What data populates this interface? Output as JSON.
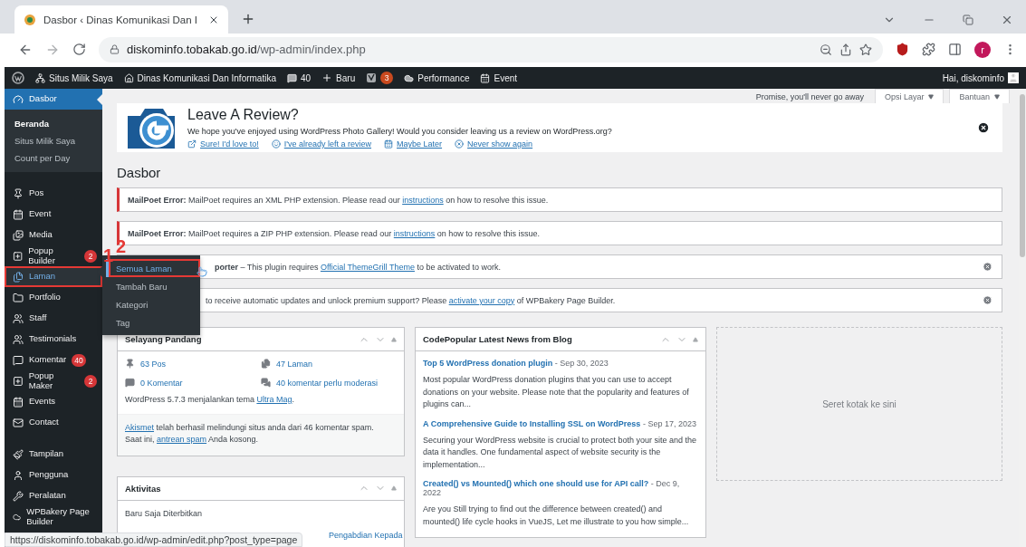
{
  "browser": {
    "tab_title": "Dasbor ‹ Dinas Komunikasi Dan I",
    "host": "diskominfo.tobakab.go.id",
    "path": "/wp-admin/index.php",
    "profile": "r"
  },
  "admin_bar": {
    "site": "Situs Milik Saya",
    "home": "Dinas Komunikasi Dan Informatika",
    "comments": "40",
    "new": "Baru",
    "seo_badge": "3",
    "performance": "Performance",
    "event": "Event",
    "greeting": "Hai, diskominfo"
  },
  "sidebar": {
    "groups": [
      [
        {
          "label": "Dasbor",
          "current": true,
          "hover": false,
          "boxed": false,
          "submenu": [
            {
              "label": "Beranda",
              "current": true
            },
            {
              "label": "Situs Milik Saya",
              "current": false
            },
            {
              "label": "Count per Day",
              "current": false
            }
          ]
        }
      ],
      [
        {
          "label": "Pos",
          "current": false,
          "hover": false,
          "boxed": false
        },
        {
          "label": "Event",
          "current": false,
          "hover": false,
          "boxed": false
        },
        {
          "label": "Media",
          "current": false,
          "hover": false,
          "boxed": false
        },
        {
          "label": "Popup Builder",
          "badge": "2",
          "current": false,
          "hover": false,
          "boxed": false
        },
        {
          "label": "Laman",
          "current": false,
          "hover": true,
          "boxed": true
        },
        {
          "label": "Portfolio",
          "current": false,
          "hover": false,
          "boxed": false
        },
        {
          "label": "Staff",
          "current": false,
          "hover": false,
          "boxed": false
        },
        {
          "label": "Testimonials",
          "current": false,
          "hover": false,
          "boxed": false
        },
        {
          "label": "Komentar",
          "badge": "40",
          "current": false,
          "hover": false,
          "boxed": false
        },
        {
          "label": "Popup Maker",
          "badge": "2",
          "current": false,
          "hover": false,
          "boxed": false
        },
        {
          "label": "Events",
          "current": false,
          "hover": false,
          "boxed": false
        },
        {
          "label": "Contact",
          "current": false,
          "hover": false,
          "boxed": false
        }
      ],
      [
        {
          "label": "Tampilan",
          "current": false,
          "hover": false,
          "boxed": false
        },
        {
          "label": "Pengguna",
          "current": false,
          "hover": false,
          "boxed": false
        },
        {
          "label": "Peralatan",
          "current": false,
          "hover": false,
          "boxed": false
        },
        {
          "label": "WPBakery Page Builder",
          "current": false,
          "hover": false,
          "boxed": false
        }
      ]
    ]
  },
  "flyout": {
    "items": [
      {
        "label": "Semua Laman",
        "hover": true,
        "boxed": true
      },
      {
        "label": "Tambah Baru",
        "hover": false,
        "boxed": false
      },
      {
        "label": "Kategori",
        "hover": false,
        "boxed": false
      },
      {
        "label": "Tag",
        "hover": false,
        "boxed": false
      }
    ]
  },
  "annotations": [
    "1",
    "2"
  ],
  "screen_meta": {
    "notice": "Promise, you'll never go away",
    "options": "Opsi Layar",
    "help": "Bantuan"
  },
  "review": {
    "title": "Leave A Review?",
    "text": "We hope you've enjoyed using WordPress Photo Gallery! Would you consider leaving us a review on WordPress.org?",
    "links": [
      "Sure! I'd love to!",
      "I've already left a review",
      "Maybe Later",
      "Never show again"
    ]
  },
  "heading": "Dasbor",
  "notices": [
    {
      "kind": "error",
      "dismissible": false,
      "parts": [
        {
          "kind": "bold",
          "text": "MailPoet Error:"
        },
        {
          "kind": "text",
          "text": " MailPoet requires an XML PHP extension. Please read our "
        },
        {
          "kind": "link",
          "text": "instructions"
        },
        {
          "kind": "text",
          "text": " on how to resolve this issue."
        }
      ]
    },
    {
      "kind": "error",
      "dismissible": false,
      "parts": [
        {
          "kind": "bold",
          "text": "MailPoet Error:"
        },
        {
          "kind": "text",
          "text": " MailPoet requires a ZIP PHP extension. Please read our "
        },
        {
          "kind": "link",
          "text": "instructions"
        },
        {
          "kind": "text",
          "text": " on how to resolve this issue."
        }
      ]
    },
    {
      "kind": "info",
      "dismissible": true,
      "parts": [
        {
          "kind": "bold",
          "text": "porter"
        },
        {
          "kind": "text",
          "text": " – This plugin requires "
        },
        {
          "kind": "link",
          "text": "Official ThemeGrill Theme"
        },
        {
          "kind": "text",
          "text": " to be activated to work."
        }
      ]
    },
    {
      "kind": "info",
      "dismissible": true,
      "parts": [
        {
          "kind": "text",
          "text": "to receive automatic updates and unlock premium support? Please "
        },
        {
          "kind": "link",
          "text": "activate your copy"
        },
        {
          "kind": "text",
          "text": " of WPBakery Page Builder."
        }
      ]
    }
  ],
  "glance": {
    "title": "Selayang Pandang",
    "stats": [
      "63 Pos",
      "47 Laman",
      "0 Komentar",
      "40 komentar perlu moderasi"
    ],
    "theme_line": [
      {
        "kind": "text",
        "text": "WordPress 5.7.3 menjalankan tema "
      },
      {
        "kind": "link",
        "text": "Ultra Mag"
      },
      {
        "kind": "text",
        "text": "."
      }
    ],
    "spam_lines": [
      [
        {
          "kind": "link",
          "text": "Akismet"
        },
        {
          "kind": "text",
          "text": " telah berhasil melindungi situs anda dari 46 komentar spam."
        }
      ],
      [
        {
          "kind": "text",
          "text": "Saat ini, "
        },
        {
          "kind": "link",
          "text": "antrean spam"
        },
        {
          "kind": "text",
          "text": " Anda kosong."
        }
      ]
    ]
  },
  "activity": {
    "title": "Aktivitas",
    "subtitle": "Baru Saja Diterbitkan",
    "partial_link": "Pengabdian Kepada"
  },
  "news": {
    "title": "CodePopular Latest News from Blog",
    "items": [
      {
        "title": "Top 5 WordPress donation plugin",
        "date": " - Sep 30, 2023",
        "excerpt": "Most popular WordPress donation plugins that you can use to accept donations on your website. Please note that the popularity and features of plugins can..."
      },
      {
        "title": "A Comprehensive Guide to Installing SSL on WordPress",
        "date": " - Sep 17, 2023",
        "excerpt": "Securing your WordPress website is crucial to protect both your site and the data it handles. One fundamental aspect of website security is the implementation..."
      },
      {
        "title": "Created() vs Mounted() which one should use for API call?",
        "date": " - Dec 9, 2022",
        "excerpt": "Are you Still trying to find out the difference between created() and mounted() life cycle hooks in VueJS, Let me illustrate to you how simple..."
      }
    ]
  },
  "drop_zone": "Seret kotak ke sini",
  "status_url": "https://diskominfo.tobakab.go.id/wp-admin/edit.php?post_type=page"
}
